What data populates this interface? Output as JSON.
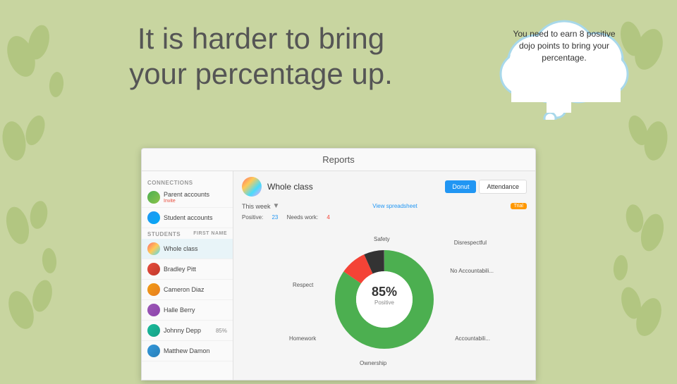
{
  "page": {
    "background_color": "#c8d5a0",
    "title_line1": "It is harder to bring",
    "title_line2": "your percentage up."
  },
  "cloud": {
    "text": "You need to earn 8 positive dojo points to bring your percentage."
  },
  "app": {
    "header": "Reports",
    "top_bar": {
      "class_name": "Whole class",
      "btn_donut": "Donut",
      "btn_attendance": "Attendance"
    },
    "week": {
      "label": "This week",
      "arrow": "▼",
      "view_link": "View spreadsheet",
      "badge": "Trial"
    },
    "stats": {
      "positive_label": "Positive:",
      "positive_val": "23",
      "needs_label": "Needs work:",
      "needs_val": "4"
    },
    "donut": {
      "percentage": "85%",
      "label": "Positive"
    },
    "sidebar": {
      "connections_label": "CONNECTIONS",
      "parent_accounts": "Parent accounts",
      "parent_sub": "Invite",
      "student_accounts": "Student accounts",
      "students_label": "STUDENTS",
      "first_name_label": "First name",
      "students": [
        {
          "name": "Whole class",
          "active": true,
          "pct": ""
        },
        {
          "name": "Bradley Pitt",
          "active": false,
          "pct": ""
        },
        {
          "name": "Cameron Diaz",
          "active": false,
          "pct": ""
        },
        {
          "name": "Halle Berry",
          "active": false,
          "pct": ""
        },
        {
          "name": "Johnny Depp",
          "active": false,
          "pct": "85%"
        },
        {
          "name": "Matthew Damon",
          "active": false,
          "pct": ""
        }
      ]
    },
    "chart_labels": {
      "safety": "Safety",
      "disrespectful": "Disrespectful",
      "no_accountability": "No Accountabili...",
      "respect": "Respect",
      "homework": "Homework",
      "ownership": "Ownership",
      "accountability": "Accountabili..."
    }
  }
}
